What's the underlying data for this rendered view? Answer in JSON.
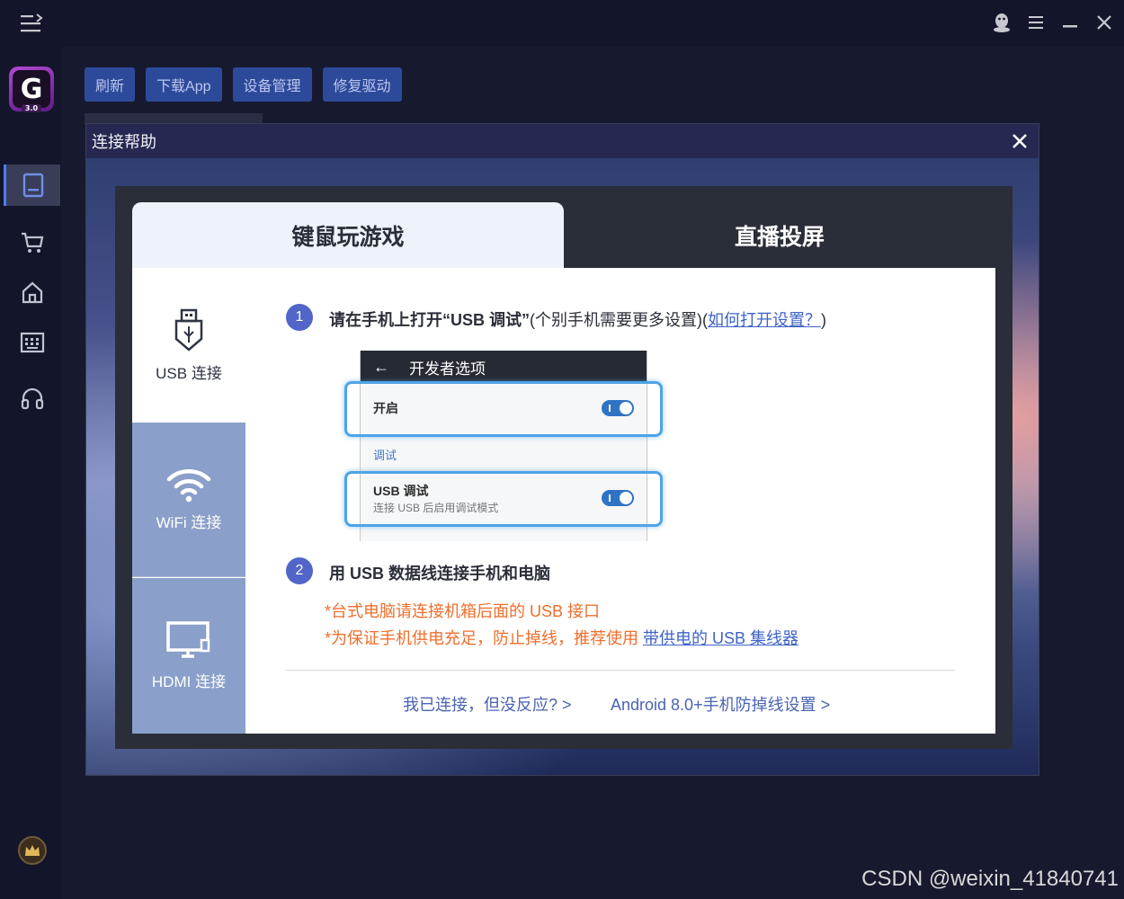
{
  "toolbar": {
    "buttons": [
      "刷新",
      "下载App",
      "设备管理",
      "修复驱动"
    ]
  },
  "sidebar": {
    "logo_version": "3.0",
    "items": [
      "device-icon",
      "cart-icon",
      "home-icon",
      "keyboard-icon",
      "headset-icon"
    ]
  },
  "modal": {
    "title": "连接帮助",
    "tabs": [
      "键鼠玩游戏",
      "直播投屏"
    ],
    "connections": [
      "USB 连接",
      "WiFi 连接",
      "HDMI 连接"
    ],
    "step1": {
      "number": "1",
      "bold": "请在手机上打开“USB 调试”",
      "normal": "(个别手机需要更多设置)(",
      "link": "如何打开设置？",
      "close": ")"
    },
    "phone": {
      "header": "开发者选项",
      "row1": "开启",
      "section": "调试",
      "row2_title": "USB 调试",
      "row2_sub": "连接 USB 后启用调试模式"
    },
    "step2": {
      "number": "2",
      "text": "用 USB 数据线连接手机和电脑"
    },
    "notes": {
      "note1": "*台式电脑请连接机箱后面的 USB 接口",
      "note2_prefix": "*为保证手机供电充足，防止掉线，推荐使用 ",
      "note2_link": "带供电的 USB 集线器"
    },
    "footer": {
      "link1": "我已连接，但没反应? >",
      "link2": "Android 8.0+手机防掉线设置 >"
    }
  },
  "watermark": "CSDN @weixin_41840741",
  "colors": {
    "accent": "#5166c8",
    "toolbar_button": "#2d4a9a",
    "note": "#f06e2c",
    "link": "#3f63c6",
    "connection_inactive": "#8a9fc9"
  }
}
